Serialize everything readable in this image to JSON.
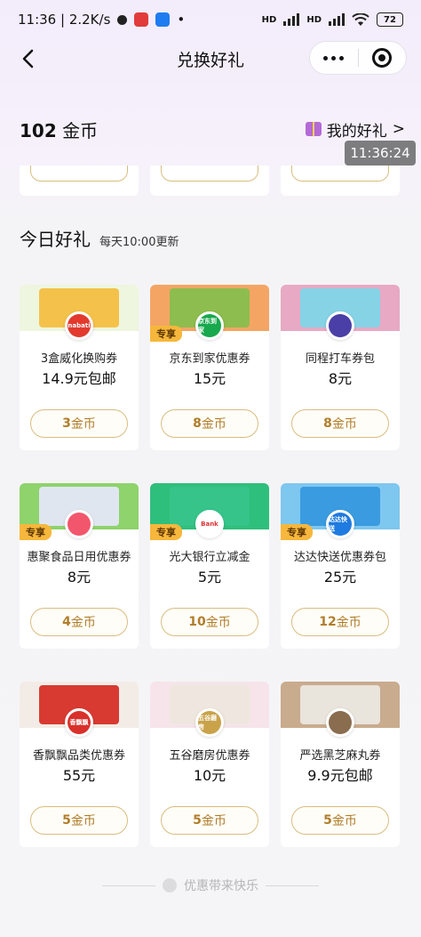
{
  "status_bar": {
    "time_speed": "11:36 | 2.2K/s",
    "dot": "•",
    "network_1": "HD",
    "network_2": "HD",
    "battery": "72"
  },
  "nav": {
    "title": "兑换好礼",
    "back_icon": "chevron-left-icon",
    "more_icon": "more-dots-icon",
    "close_icon": "target-circle-icon"
  },
  "header": {
    "coin_count": "102",
    "coin_unit": "金币",
    "my_gifts_label": "我的好礼",
    "my_gifts_arrow": ">",
    "time_overlay": "11:36:24"
  },
  "section": {
    "title": "今日好礼",
    "subtitle": "每天10:00更新"
  },
  "coin_suffix": "金币",
  "exclusive_label": "专享",
  "cards": [
    {
      "name": "3盒威化换购券",
      "value": "14.9元包邮",
      "cost": "3",
      "exclusive": false,
      "logo_text": "nabati",
      "colors": {
        "bg": "#eef6df",
        "thumb": "#f4c24a",
        "logo": "#e23a2e"
      }
    },
    {
      "name": "京东到家优惠券",
      "value": "15元",
      "cost": "8",
      "exclusive": true,
      "logo_text": "京东到家",
      "colors": {
        "bg": "#f4a564",
        "thumb": "#8dbd4e",
        "logo": "#18a84d"
      }
    },
    {
      "name": "同程打车券包",
      "value": "8元",
      "cost": "8",
      "exclusive": false,
      "logo_text": "",
      "colors": {
        "bg": "#e7a9c3",
        "thumb": "#86d3e6",
        "logo": "#4a3fa6"
      }
    },
    {
      "name": "惠聚食品日用优惠券",
      "value": "8元",
      "cost": "4",
      "exclusive": true,
      "logo_text": "",
      "colors": {
        "bg": "#8ed36b",
        "thumb": "#dfe6ef",
        "logo": "#f2566d"
      }
    },
    {
      "name": "光大银行立减金",
      "value": "5元",
      "cost": "10",
      "exclusive": true,
      "logo_text": "Bank",
      "colors": {
        "bg": "#2fbf7c",
        "thumb": "#36c48a",
        "logo": "#ffffff"
      }
    },
    {
      "name": "达达快送优惠券包",
      "value": "25元",
      "cost": "12",
      "exclusive": true,
      "logo_text": "达达快送",
      "colors": {
        "bg": "#7ec7ef",
        "thumb": "#3a9be0",
        "logo": "#1f7be0"
      }
    },
    {
      "name": "香飘飘品类优惠券",
      "value": "55元",
      "cost": "5",
      "exclusive": false,
      "logo_text": "香飘飘",
      "colors": {
        "bg": "#f3ece6",
        "thumb": "#d83a32",
        "logo": "#d9302b"
      }
    },
    {
      "name": "五谷磨房优惠券",
      "value": "10元",
      "cost": "5",
      "exclusive": false,
      "logo_text": "五谷磨房",
      "colors": {
        "bg": "#f6e4ea",
        "thumb": "#efe7df",
        "logo": "#c9a24a"
      }
    },
    {
      "name": "严选黑芝麻丸券",
      "value": "9.9元包邮",
      "cost": "5",
      "exclusive": false,
      "logo_text": "",
      "colors": {
        "bg": "#c9ab8e",
        "thumb": "#e9e4dc",
        "logo": "#8a6c4f"
      }
    }
  ],
  "footer": {
    "text": "优惠带来快乐"
  },
  "theme": {
    "accent_gold": "#d9bd80",
    "button_text": "#b07d2a",
    "tag_bg": "#f6b73c"
  }
}
